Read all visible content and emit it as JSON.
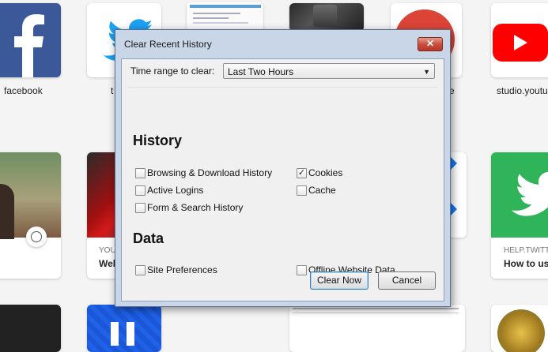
{
  "tiles": {
    "row1": [
      {
        "caption": "facebook"
      },
      {
        "caption": "t"
      },
      {
        "caption": ""
      },
      {
        "caption": ""
      },
      {
        "caption": "e"
      },
      {
        "caption": "studio.youtu"
      }
    ],
    "row2": {
      "tile2_sub": "YOU",
      "tile2_bold": "Wel",
      "tile6_sub": "HELP.TWITTE",
      "tile6_bold": "How to use"
    }
  },
  "dialog": {
    "title": "Clear Recent History",
    "close_glyph": "✕",
    "time_range_label": "Time range to clear:",
    "time_range_value": "Last Two Hours",
    "history_heading": "History",
    "history_items": [
      {
        "label": "Browsing & Download History",
        "checked": false
      },
      {
        "label": "Active Logins",
        "checked": false
      },
      {
        "label": "Form & Search History",
        "checked": false
      },
      {
        "label": "Cookies",
        "checked": true
      },
      {
        "label": "Cache",
        "checked": false
      }
    ],
    "data_heading": "Data",
    "data_items": [
      {
        "label": "Site Preferences",
        "checked": false
      },
      {
        "label": "Offline Website Data",
        "checked": false
      }
    ],
    "clear_button": "Clear Now",
    "cancel_button": "Cancel"
  },
  "colors": {
    "facebook": "#3b5998",
    "twitter": "#1da1f2",
    "youtube": "#ff0000",
    "twitter_green": "#2fb45a"
  },
  "icons": [
    "facebook-icon",
    "twitter-bird-icon",
    "youtube-play-icon",
    "google-plus-icon",
    "clock-icon",
    "close-icon",
    "dropdown-arrow-icon",
    "checkmark-icon"
  ]
}
